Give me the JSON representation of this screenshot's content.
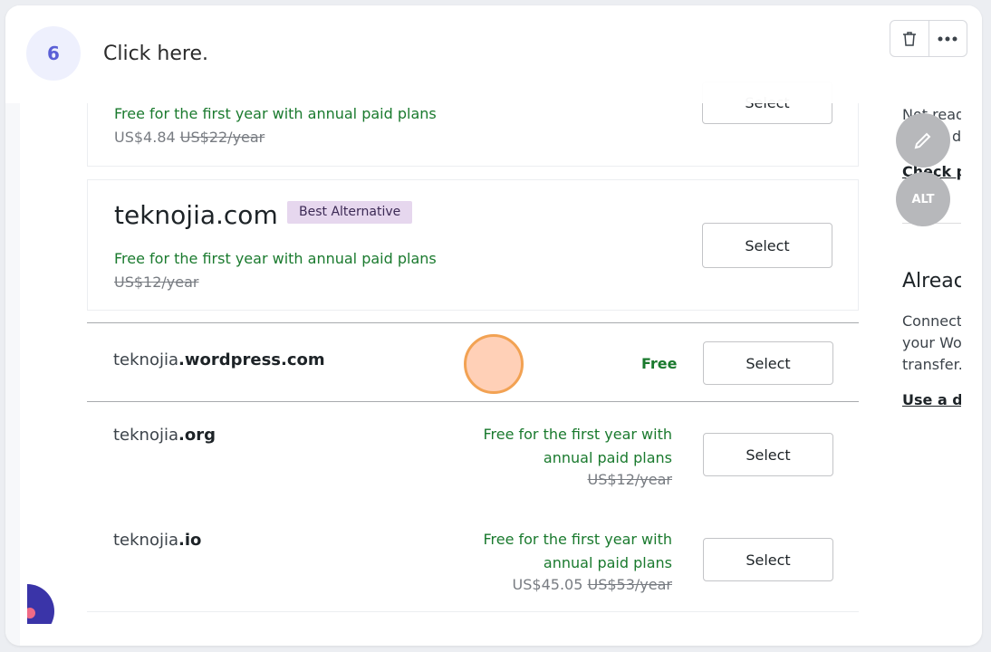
{
  "header": {
    "step_number": "6",
    "instruction": "Click here."
  },
  "top_partial_row": {
    "offer": "Free for the first year with annual paid plans",
    "price": "US$4.84",
    "original_price": "US$22/year",
    "button_label": "Select"
  },
  "featured_row": {
    "domain": "teknojia.com",
    "badge": "Best Alternative",
    "offer": "Free for the first year with annual paid plans",
    "original_price": "US$12/year",
    "button_label": "Select"
  },
  "rows": [
    {
      "name": "teknojia",
      "tld": ".wordpress.com",
      "price_text": "Free",
      "button_label": "Select"
    },
    {
      "name": "teknojia",
      "tld": ".org",
      "offer_line1": "Free for the first year with",
      "offer_line2": "annual paid plans",
      "original_price": "US$12/year",
      "button_label": "Select"
    },
    {
      "name": "teknojia",
      "tld": ".io",
      "offer_line1": "Free for the first year with",
      "offer_line2": "annual paid plans",
      "price": "US$45.05",
      "original_price": "US$53/year",
      "button_label": "Select"
    }
  ],
  "right_panel": {
    "line1": "Not read",
    "line2": "d",
    "check_link": "Check pa",
    "already_title": "Alreac",
    "connect_line1": "Connect",
    "connect_line2": "your Wor",
    "connect_line3": "transfer.",
    "use_link": "Use a do"
  },
  "fab": {
    "alt_label": "ALT"
  },
  "colors": {
    "green_offer": "#1a7a2e",
    "badge_bg": "#e6d7ee",
    "badge_text": "#3c2a55",
    "step_badge_bg": "#eef0fd",
    "step_badge_text": "#5a5fd6",
    "click_marker": "#f2a253"
  }
}
